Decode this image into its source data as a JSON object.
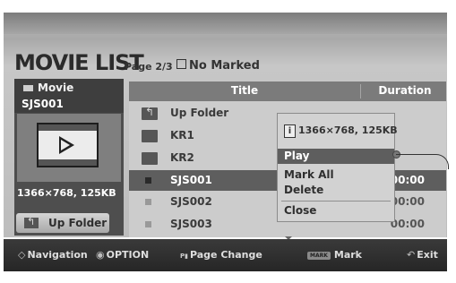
{
  "header": {
    "title": "MOVIE LIST",
    "page_indicator": "Page 2/3",
    "marked_status": "No Marked"
  },
  "preview": {
    "category": "Movie",
    "file_name": "SJS001",
    "resolution_size": "1366×768, 125KB",
    "up_folder_label": "Up Folder"
  },
  "list": {
    "columns": {
      "title": "Title",
      "duration": "Duration"
    },
    "rows": [
      {
        "type": "up-folder",
        "name": "Up Folder",
        "duration": ""
      },
      {
        "type": "folder",
        "name": "KR1",
        "duration": ""
      },
      {
        "type": "folder",
        "name": "KR2",
        "duration": ""
      },
      {
        "type": "file",
        "name": "SJS001",
        "duration": "00:00",
        "selected": true
      },
      {
        "type": "file",
        "name": "SJS002",
        "duration": "00:00"
      },
      {
        "type": "file",
        "name": "SJS003",
        "duration": "00:00"
      }
    ]
  },
  "popup": {
    "info": "1366×768, 125KB",
    "items": [
      "Play",
      "Mark All",
      "Delete",
      "Close"
    ],
    "selected": "Play"
  },
  "footer": {
    "navigation": "Navigation",
    "option": "OPTION",
    "page_change": "Page Change",
    "mark_badge": "MARK",
    "mark": "Mark",
    "exit": "Exit"
  },
  "colors": {
    "header_gray": "#7b7b7b",
    "selected_row": "#5e5e5e",
    "footer_bg": "#2f2f2f"
  }
}
